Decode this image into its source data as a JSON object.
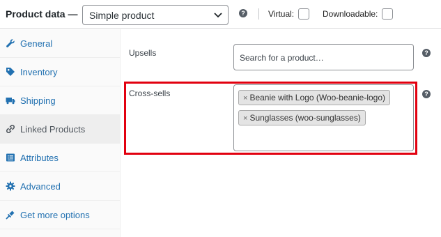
{
  "header": {
    "title": "Product data —",
    "product_type": {
      "selected": "Simple product"
    },
    "help_glyph": "?",
    "virtual_label": "Virtual:",
    "downloadable_label": "Downloadable:",
    "virtual_checked": false,
    "downloadable_checked": false
  },
  "sidebar": {
    "items": [
      {
        "label": "General",
        "icon": "wrench-icon",
        "active": false
      },
      {
        "label": "Inventory",
        "icon": "tag-icon",
        "active": false
      },
      {
        "label": "Shipping",
        "icon": "truck-icon",
        "active": false
      },
      {
        "label": "Linked Products",
        "icon": "link-icon",
        "active": true
      },
      {
        "label": "Attributes",
        "icon": "list-icon",
        "active": false
      },
      {
        "label": "Advanced",
        "icon": "gear-icon",
        "active": false
      },
      {
        "label": "Get more options",
        "icon": "plugin-icon",
        "active": false
      }
    ]
  },
  "main": {
    "upsells": {
      "label": "Upsells",
      "placeholder": "Search for a product…"
    },
    "cross_sells": {
      "label": "Cross-sells",
      "remove_glyph": "×",
      "tags": [
        "Beanie with Logo (Woo-beanie-logo)",
        "Sunglasses (woo-sunglasses)"
      ]
    }
  },
  "colors": {
    "link": "#2271b1",
    "highlight": "#e2000f",
    "active_tab_bg": "#eeeeee"
  }
}
